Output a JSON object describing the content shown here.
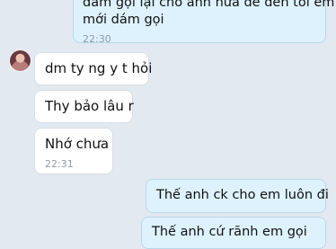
{
  "messages": [
    {
      "direction": "out",
      "lines": [
        "đám gọi lại cho anh nữa để đến tối em",
        "mới dám gọi"
      ],
      "time": "22:30"
    },
    {
      "direction": "in",
      "text": "dm ty ng y t hỏi"
    },
    {
      "direction": "in",
      "text": "Thy bảo lâu r"
    },
    {
      "direction": "in",
      "text": "Nhớ chưa",
      "time": "22:31"
    },
    {
      "direction": "out",
      "text": "Thế anh ck cho em luôn đi"
    },
    {
      "direction": "out",
      "text": "Thế anh cứ rãnh em gọi"
    }
  ],
  "colors": {
    "background": "#e2e9f1",
    "outgoing_bubble": "#ddf2fd",
    "incoming_bubble": "#ffffff",
    "timestamp": "#8f9aa5"
  }
}
